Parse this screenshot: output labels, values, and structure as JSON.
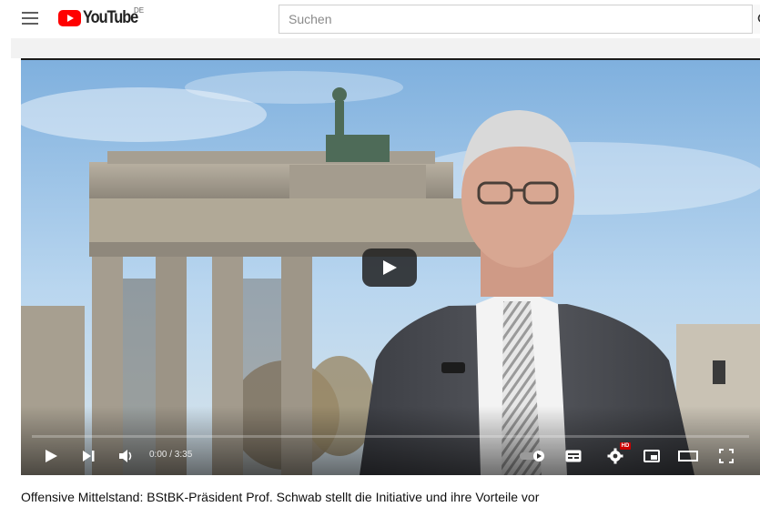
{
  "header": {
    "logo_text": "YouTube",
    "country_code": "DE",
    "search_placeholder": "Suchen"
  },
  "player": {
    "time_display": "0:00 / 3:35",
    "quality_badge": "HD",
    "controls": [
      "play-icon",
      "next-icon",
      "volume-icon",
      "autoplay-toggle-icon",
      "subtitles-icon",
      "settings-icon",
      "miniplayer-icon",
      "theater-mode-icon",
      "fullscreen-icon"
    ]
  },
  "video": {
    "title": "Offensive Mittelstand: BStBK-Präsident Prof. Schwab stellt die Initiative und ihre Vorteile vor"
  },
  "colors": {
    "brand_red": "#FF0000",
    "hd_badge": "#CC0000",
    "sky": "#9cc3e6"
  }
}
